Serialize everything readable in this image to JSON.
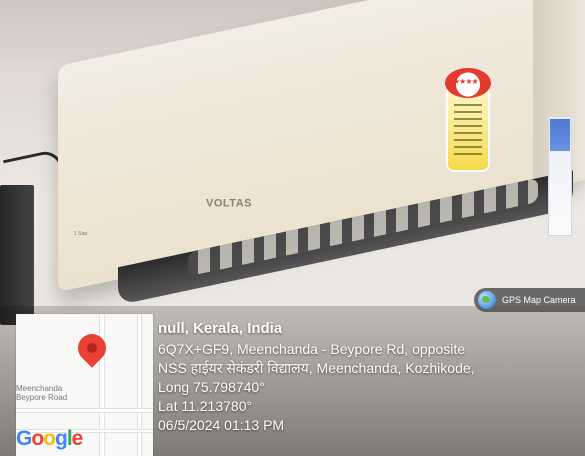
{
  "photo": {
    "brand": "VOLTAS",
    "small_text": "1 Star",
    "badge_text": "★★★★"
  },
  "map": {
    "label_lines": [
      "Meenchanda",
      "Beypore Road"
    ],
    "logo": "Google"
  },
  "gps_badge": {
    "label": "GPS Map Camera"
  },
  "location": {
    "title": "null, Kerala, India",
    "address_line_1": "6Q7X+GF9, Meenchanda - Beypore Rd, opposite",
    "address_line_2": "NSS हाईयर सेकंडरी विद्यालय, Meenchanda, Kozhikode,",
    "long_label": "Long 75.798740°",
    "lat_label": "Lat 11.213780°",
    "timestamp": "06/5/2024 01:13 PM"
  },
  "icons": {
    "pin": "map-pin-icon",
    "globe": "globe-icon"
  }
}
